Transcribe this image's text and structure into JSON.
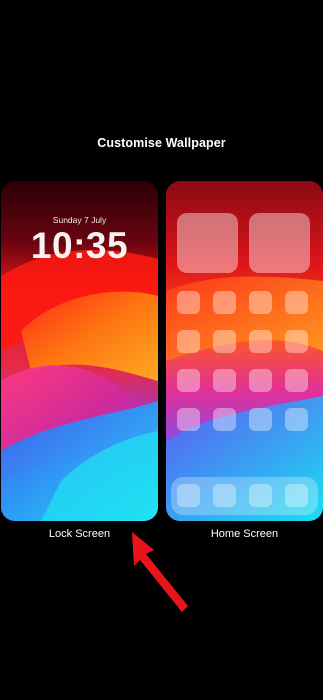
{
  "header": {
    "title": "Customise Wallpaper"
  },
  "lock_screen": {
    "date": "Sunday 7 July",
    "time": "10:35",
    "caption": "Lock Screen"
  },
  "home_screen": {
    "caption": "Home Screen"
  },
  "colors": {
    "background": "#000000",
    "text": "#ffffff",
    "arrow": "#e8141c",
    "wallpaper": [
      "#2a0006",
      "#e0151a",
      "#ff6a00",
      "#d12a9a",
      "#8a3cf0",
      "#2a6cf5",
      "#19d5f2"
    ]
  },
  "icons": {
    "annotation": "red-arrow-icon"
  }
}
